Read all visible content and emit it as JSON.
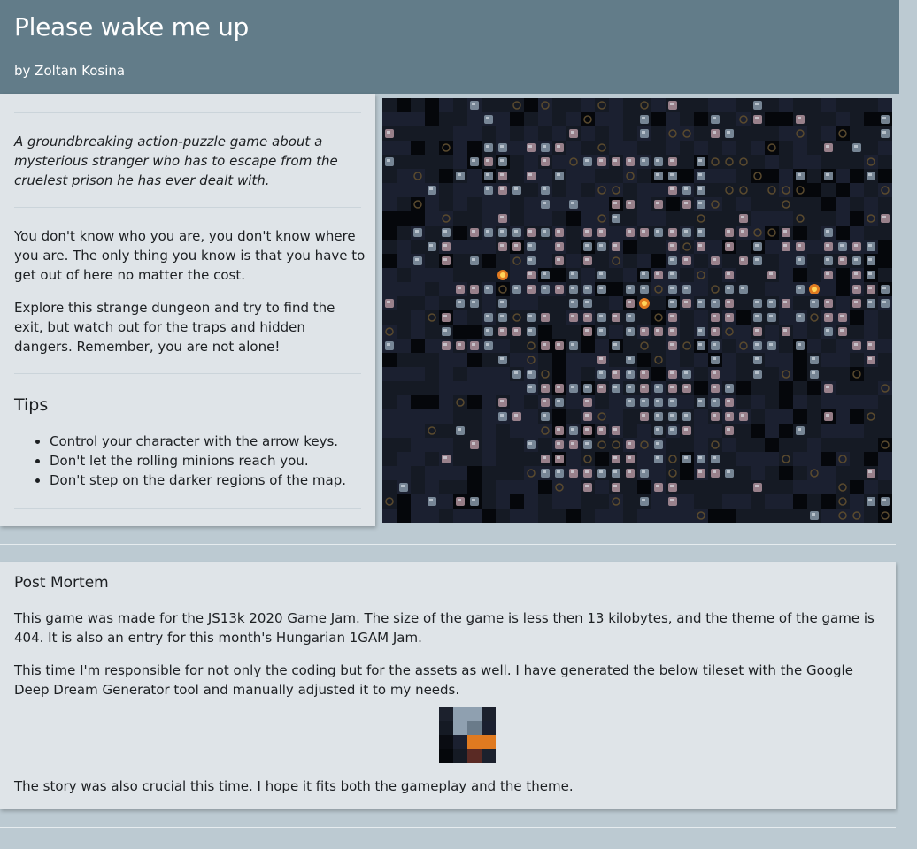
{
  "header": {
    "title": "Please wake me up",
    "author": "by Zoltan Kosina",
    "background": "#627c89"
  },
  "intro": {
    "tagline": "A groundbreaking action-puzzle game about a mysterious stranger who has to escape from the cruelest prison he has ever dealt with.",
    "story": "You don't know who you are, you don't know where you are. The only thing you know is that you have to get out of here no matter the cost.",
    "explore": "Explore this strange dungeon and try to find the exit, but watch out for the traps and hidden dangers. Remember, you are not alone!"
  },
  "tips": {
    "title": "Tips",
    "items": [
      "Control your character with the arrow keys.",
      "Don't let the rolling minions reach you.",
      "Don't step on the darker regions of the map."
    ]
  },
  "postmortem": {
    "title": "Post Mortem",
    "paragraphs": [
      "This game was made for the JS13k 2020 Game Jam. The size of the game is less then 13 kilobytes, and the theme of the game is 404. It is also an entry for this month's Hungarian 1GAM Jam.",
      "This time I'm responsible for not only the coding but for the assets as well. I have generated the below tileset with the Google Deep Dream Generator tool and manually adjusted it to my needs.",
      "The story was also crucial this time. I hope it fits both the gameplay and the theme."
    ]
  },
  "colors": {
    "page_bg": "#bccad2",
    "panel_bg": "#dfe4e8",
    "canvas_bg": "#10131a",
    "stone": "#8fa0b0",
    "stone_pink": "#b99aa4",
    "fire": "#e07a20"
  }
}
